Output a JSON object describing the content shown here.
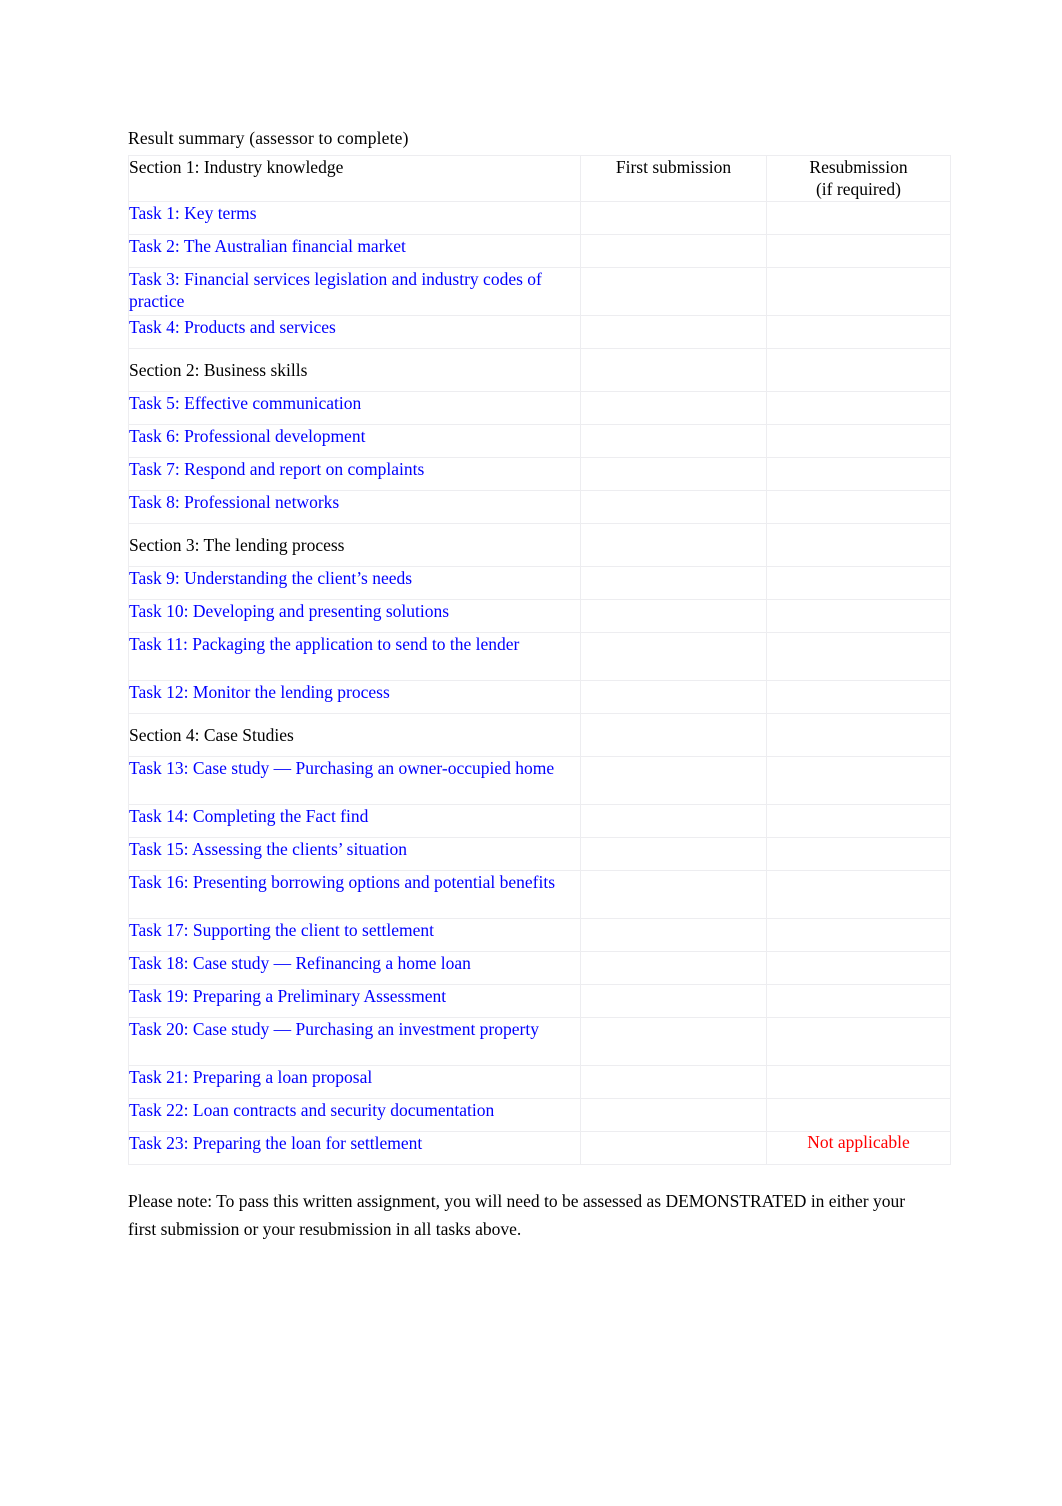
{
  "document": {
    "title": "Result summary (assessor to complete)",
    "footnote": "Please note:  To pass this written assignment, you will need to be assessed as DEMONSTRATED in either your first submission or your resubmission in all tasks above."
  },
  "table": {
    "columns": {
      "task": "",
      "first_submission": "First submission",
      "resubmission_line1": "Resubmission",
      "resubmission_line2": "(if required)"
    },
    "colors": {
      "task_text": "#0000ff",
      "section_text": "#000000",
      "not_applicable_text": "#ff0000",
      "border": "#ededf0"
    },
    "rows": [
      {
        "type": "section",
        "label": "Section 1: Industry knowledge",
        "first": "",
        "resubmission": ""
      },
      {
        "type": "task",
        "label": "Task 1: Key terms",
        "first": "",
        "resubmission": ""
      },
      {
        "type": "task",
        "label": "Task 2: The Australian financial market",
        "first": "",
        "resubmission": ""
      },
      {
        "type": "task",
        "label": "Task 3: Financial services legislation and industry codes of practice",
        "first": "",
        "resubmission": ""
      },
      {
        "type": "task",
        "label": "Task 4: Products and services",
        "first": "",
        "resubmission": ""
      },
      {
        "type": "section",
        "label": "Section 2: Business skills",
        "first": "",
        "resubmission": ""
      },
      {
        "type": "task",
        "label": "Task 5: Effective communication",
        "first": "",
        "resubmission": ""
      },
      {
        "type": "task",
        "label": "Task 6: Professional development",
        "first": "",
        "resubmission": ""
      },
      {
        "type": "task",
        "label": "Task 7: Respond and report on complaints",
        "first": "",
        "resubmission": ""
      },
      {
        "type": "task",
        "label": "Task 8: Professional networks",
        "first": "",
        "resubmission": ""
      },
      {
        "type": "section",
        "label": "Section 3: The lending process",
        "first": "",
        "resubmission": ""
      },
      {
        "type": "task",
        "label": "Task 9: Understanding the client’s needs",
        "first": "",
        "resubmission": ""
      },
      {
        "type": "task",
        "label": "Task 10: Developing and presenting solutions",
        "first": "",
        "resubmission": ""
      },
      {
        "type": "task",
        "label": "Task 11: Packaging the application to send to the lender",
        "first": "",
        "resubmission": ""
      },
      {
        "type": "task",
        "label": "Task 12: Monitor the lending process",
        "first": "",
        "resubmission": ""
      },
      {
        "type": "section",
        "label": "Section 4: Case Studies",
        "first": "",
        "resubmission": ""
      },
      {
        "type": "task",
        "label": "Task 13: Case study — Purchasing an owner-occupied home",
        "first": "",
        "resubmission": ""
      },
      {
        "type": "task",
        "label": "Task 14: Completing the Fact find",
        "first": "",
        "resubmission": ""
      },
      {
        "type": "task",
        "label": "Task 15: Assessing the clients’ situation",
        "first": "",
        "resubmission": ""
      },
      {
        "type": "task",
        "label": "Task 16: Presenting borrowing options and potential benefits",
        "first": "",
        "resubmission": ""
      },
      {
        "type": "task",
        "label": "Task 17: Supporting the client to settlement",
        "first": "",
        "resubmission": ""
      },
      {
        "type": "task",
        "label": "Task 18: Case study — Refinancing a home loan",
        "first": "",
        "resubmission": ""
      },
      {
        "type": "task",
        "label": "Task 19: Preparing a Preliminary Assessment",
        "first": "",
        "resubmission": ""
      },
      {
        "type": "task",
        "label": "Task 20: Case study — Purchasing an investment property",
        "first": "",
        "resubmission": ""
      },
      {
        "type": "task",
        "label": "Task 21: Preparing a loan proposal",
        "first": "",
        "resubmission": ""
      },
      {
        "type": "task",
        "label": "Task 22: Loan contracts and security documentation",
        "first": "",
        "resubmission": ""
      },
      {
        "type": "task",
        "label": "Task 23: Preparing the loan for settlement",
        "first": "",
        "resubmission": "Not applicable"
      }
    ]
  }
}
